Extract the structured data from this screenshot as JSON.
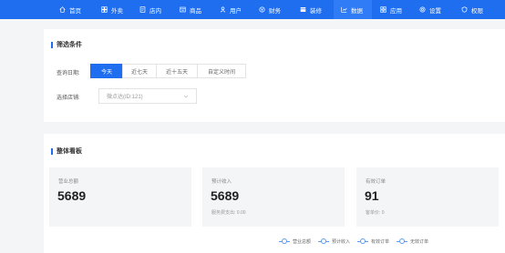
{
  "nav": {
    "items": [
      {
        "label": "首页",
        "icon": "home-icon"
      },
      {
        "label": "外卖",
        "icon": "takeout-icon"
      },
      {
        "label": "店内",
        "icon": "store-icon"
      },
      {
        "label": "商品",
        "icon": "goods-icon"
      },
      {
        "label": "用户",
        "icon": "user-icon"
      },
      {
        "label": "财务",
        "icon": "finance-icon"
      },
      {
        "label": "装修",
        "icon": "decorate-icon"
      },
      {
        "label": "数据",
        "icon": "chart-icon"
      },
      {
        "label": "应用",
        "icon": "apps-icon"
      },
      {
        "label": "设置",
        "icon": "settings-icon"
      },
      {
        "label": "权限",
        "icon": "permission-icon"
      }
    ],
    "active": "数据",
    "color": "#1f6ef0"
  },
  "filter": {
    "title": "筛选条件",
    "date_label": "查询日期:",
    "date_options": [
      "今天",
      "近七天",
      "近十五天",
      "自定义时间"
    ],
    "date_selected": "今天",
    "store_label": "选择店铺:",
    "store_value": "微点达(ID:121)"
  },
  "overview": {
    "title": "整体看板",
    "stats": [
      {
        "label": "营业总额",
        "value": "5689",
        "sub": ""
      },
      {
        "label": "预计收入",
        "value": "5689",
        "sub": "服务费支出: 0.00"
      },
      {
        "label": "有效订单",
        "value": "91",
        "sub": "客单价: 0"
      }
    ],
    "legend": [
      {
        "label": "营业总额",
        "color": "#5b9bf0"
      },
      {
        "label": "预计收入",
        "color": "#5b9bf0"
      },
      {
        "label": "有效订单",
        "color": "#5b9bf0"
      },
      {
        "label": "无效订单",
        "color": "#5b9bf0"
      }
    ]
  }
}
